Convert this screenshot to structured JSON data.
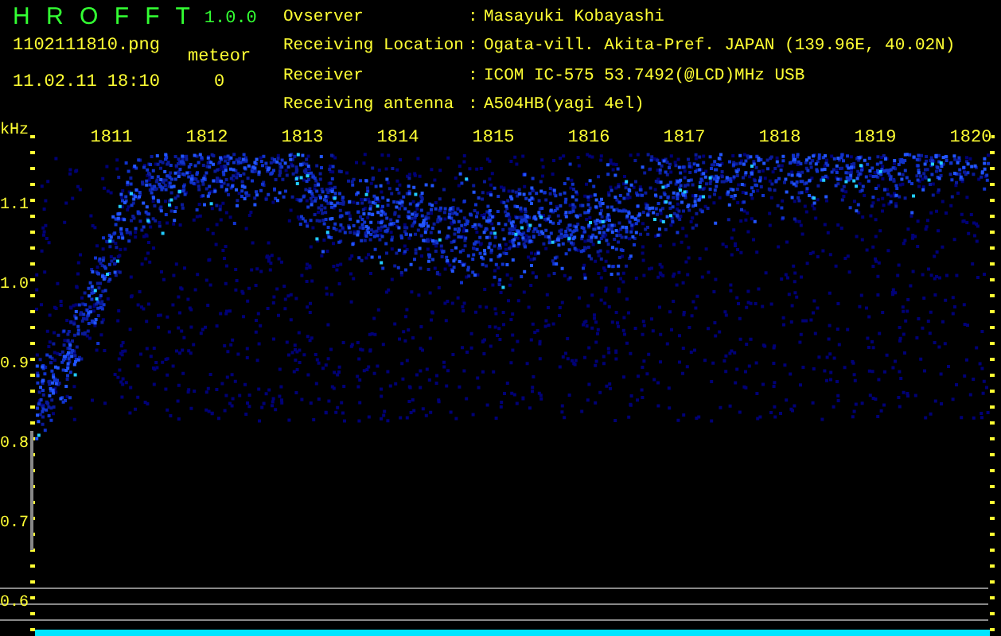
{
  "app": {
    "name": "H R O F F T",
    "version": "1.0.0"
  },
  "file": "1102111810.png",
  "timestamp": "11.02.11 18:10",
  "meteor": {
    "label": "meteor",
    "count": "0"
  },
  "info": [
    {
      "label": "Ovserver",
      "separator": ":",
      "value": "Masayuki Kobayashi"
    },
    {
      "label": "Receiving Location",
      "separator": ":",
      "value": "Ogata-vill. Akita-Pref. JAPAN (139.96E, 40.02N)"
    },
    {
      "label": "Receiver",
      "separator": ":",
      "value": "ICOM IC-575 53.7492(@LCD)MHz USB"
    },
    {
      "label": "Receiving antenna",
      "separator": ":",
      "value": "A504HB(yagi 4el)"
    }
  ],
  "spectrogram": {
    "y_unit": "kHz",
    "x_labels": [
      "1811",
      "1812",
      "1813",
      "1814",
      "1815",
      "1816",
      "1817",
      "1818",
      "1819",
      "1820"
    ],
    "y_labels": [
      "1.1",
      "1.0",
      "0.9",
      "0.8",
      "0.7",
      "0.6"
    ]
  }
}
